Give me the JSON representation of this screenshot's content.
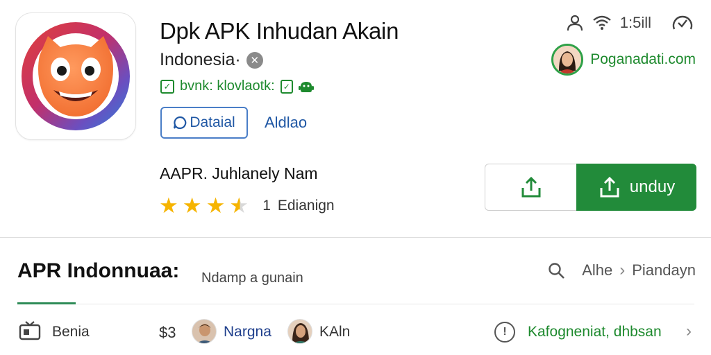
{
  "app": {
    "title": "Dpk APK Inhudan Akain",
    "subtitle": "Indonesia·",
    "tag": "bvnk: klovlaotk:",
    "detail_button": "Dataial",
    "link": "Aldlao",
    "developer": "AAPR. Juhlanely Nam",
    "rating_count": "1",
    "rating_label": "Edianign",
    "rating_value": 3.5
  },
  "status": {
    "time": "1:5ill"
  },
  "account": {
    "name": "Poganadati.com"
  },
  "actions": {
    "install_label": "unduy"
  },
  "section": {
    "title": "APR Indonnuaa:",
    "subtitle": "Ndamp a gunain",
    "search_tab": "Alhe",
    "search_tab2": "Piandayn"
  },
  "bottom": {
    "category": "Benia",
    "price": "$3",
    "person1": "Nargna",
    "person2": "KAln",
    "link": "Kafogneniat, dhbsan"
  },
  "colors": {
    "accent_green": "#228b3a",
    "link_blue": "#1f57a4",
    "star": "#f6b400"
  }
}
